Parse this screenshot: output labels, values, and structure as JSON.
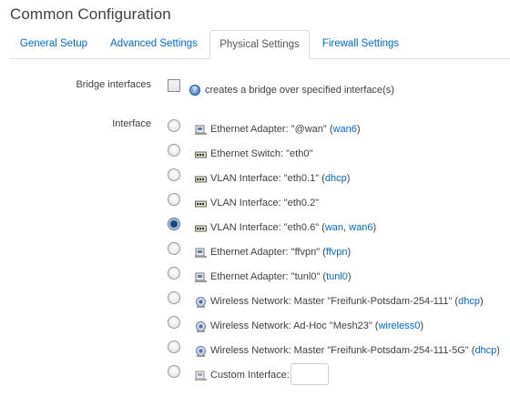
{
  "page": {
    "title": "Common Configuration"
  },
  "tabs": [
    {
      "label": "General Setup",
      "active": false
    },
    {
      "label": "Advanced Settings",
      "active": false
    },
    {
      "label": "Physical Settings",
      "active": true
    },
    {
      "label": "Firewall Settings",
      "active": false
    }
  ],
  "bridge": {
    "label": "Bridge interfaces",
    "checked": false,
    "help_icon": "help-icon",
    "help_text": "creates a bridge over specified interface(s)"
  },
  "interface": {
    "label": "Interface",
    "options": [
      {
        "icon": "ethernet-adapter-icon",
        "text": "Ethernet Adapter: \"@wan\" (",
        "links": [
          "wan6"
        ],
        "suffix": ")",
        "checked": false
      },
      {
        "icon": "ethernet-switch-icon",
        "text": "Ethernet Switch: \"eth0\"",
        "links": [],
        "suffix": "",
        "checked": false
      },
      {
        "icon": "vlan-interface-icon",
        "text": "VLAN Interface: \"eth0.1\" (",
        "links": [
          "dhcp"
        ],
        "suffix": ")",
        "checked": false
      },
      {
        "icon": "vlan-interface-icon",
        "text": "VLAN Interface: \"eth0.2\"",
        "links": [],
        "suffix": "",
        "checked": false
      },
      {
        "icon": "vlan-interface-icon",
        "text": "VLAN Interface: \"eth0.6\" (",
        "links": [
          "wan",
          "wan6"
        ],
        "suffix": ")",
        "checked": true
      },
      {
        "icon": "ethernet-adapter-icon",
        "text": "Ethernet Adapter: \"ffvpn\" (",
        "links": [
          "ffvpn"
        ],
        "suffix": ")",
        "checked": false
      },
      {
        "icon": "ethernet-adapter-icon",
        "text": "Ethernet Adapter: \"tunl0\" (",
        "links": [
          "tunl0"
        ],
        "suffix": ")",
        "checked": false
      },
      {
        "icon": "wireless-network-icon",
        "text": "Wireless Network: Master \"Freifunk-Potsdam-254-111\" (",
        "links": [
          "dhcp"
        ],
        "suffix": ")",
        "checked": false
      },
      {
        "icon": "wireless-network-icon",
        "text": "Wireless Network: Ad-Hoc \"Mesh23\" (",
        "links": [
          "wireless0"
        ],
        "suffix": ")",
        "checked": false
      },
      {
        "icon": "wireless-network-icon",
        "text": "Wireless Network: Master \"Freifunk-Potsdam-254-111-5G\" (",
        "links": [
          "dhcp"
        ],
        "suffix": ")",
        "checked": false
      },
      {
        "icon": "custom-interface-icon",
        "text": "Custom Interface:",
        "links": [],
        "suffix": "",
        "checked": false
      }
    ],
    "custom_value": ""
  }
}
